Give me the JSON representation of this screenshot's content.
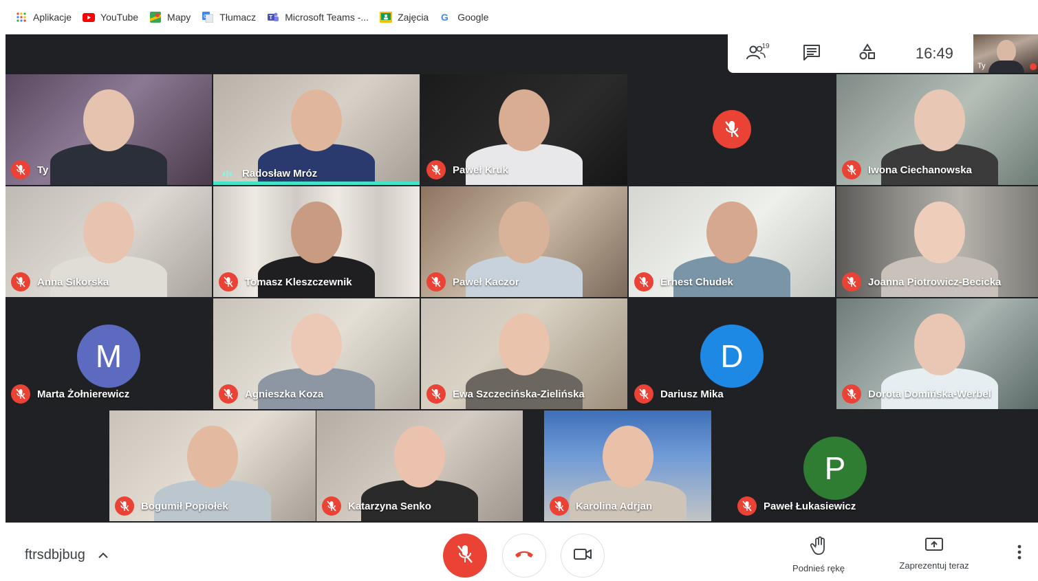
{
  "bookmarks": [
    {
      "label": "Aplikacje",
      "icon": "apps-grid-icon"
    },
    {
      "label": "YouTube",
      "icon": "youtube-icon"
    },
    {
      "label": "Mapy",
      "icon": "maps-icon"
    },
    {
      "label": "Tłumacz",
      "icon": "translate-icon"
    },
    {
      "label": "Microsoft Teams -...",
      "icon": "teams-icon"
    },
    {
      "label": "Zajęcia",
      "icon": "classroom-icon"
    },
    {
      "label": "Google",
      "icon": "google-icon"
    }
  ],
  "top_controls": {
    "participants_count": "19",
    "time": "16:49",
    "self_label": "Ty"
  },
  "participants": [
    {
      "name": "Ty",
      "muted": true
    },
    {
      "name": "Radosław Mróz",
      "muted": false,
      "speaking": true
    },
    {
      "name": "Paweł Kruk",
      "muted": true
    },
    {
      "name": "",
      "muted": true
    },
    {
      "name": "Iwona Ciechanowska",
      "muted": true
    },
    {
      "name": "Anna Sikorska",
      "muted": true
    },
    {
      "name": "Tomasz Kleszczewnik",
      "muted": true
    },
    {
      "name": "Paweł Kaczor",
      "muted": true
    },
    {
      "name": "Ernest Chudek",
      "muted": true
    },
    {
      "name": "Joanna Piotrowicz-Becicka",
      "muted": true
    },
    {
      "name": "Marta Żołnierewicz",
      "muted": true,
      "initial": "M"
    },
    {
      "name": "Agnieszka Koza",
      "muted": true
    },
    {
      "name": "Ewa Szczecińska-Zielińska",
      "muted": true
    },
    {
      "name": "Dariusz Mika",
      "muted": true,
      "initial": "D"
    },
    {
      "name": "Dorota Domińska-Werbel",
      "muted": true
    },
    {
      "name": "Bogumił Popiołek",
      "muted": true
    },
    {
      "name": "Katarzyna Senko",
      "muted": true
    },
    {
      "name": "Karolina Adrjan",
      "muted": true
    },
    {
      "name": "Paweł Łukasiewicz",
      "muted": true,
      "initial": "P"
    }
  ],
  "colors": {
    "mute_red": "#ea4335",
    "avatar_M": "#5c6bc0",
    "avatar_D": "#1e88e5",
    "avatar_P": "#2e7d32",
    "meet_bg": "#202124"
  },
  "bottom": {
    "meeting_code": "ftrsdbjbug",
    "raise_hand": "Podnieś rękę",
    "present_now": "Zaprezentuj teraz"
  }
}
